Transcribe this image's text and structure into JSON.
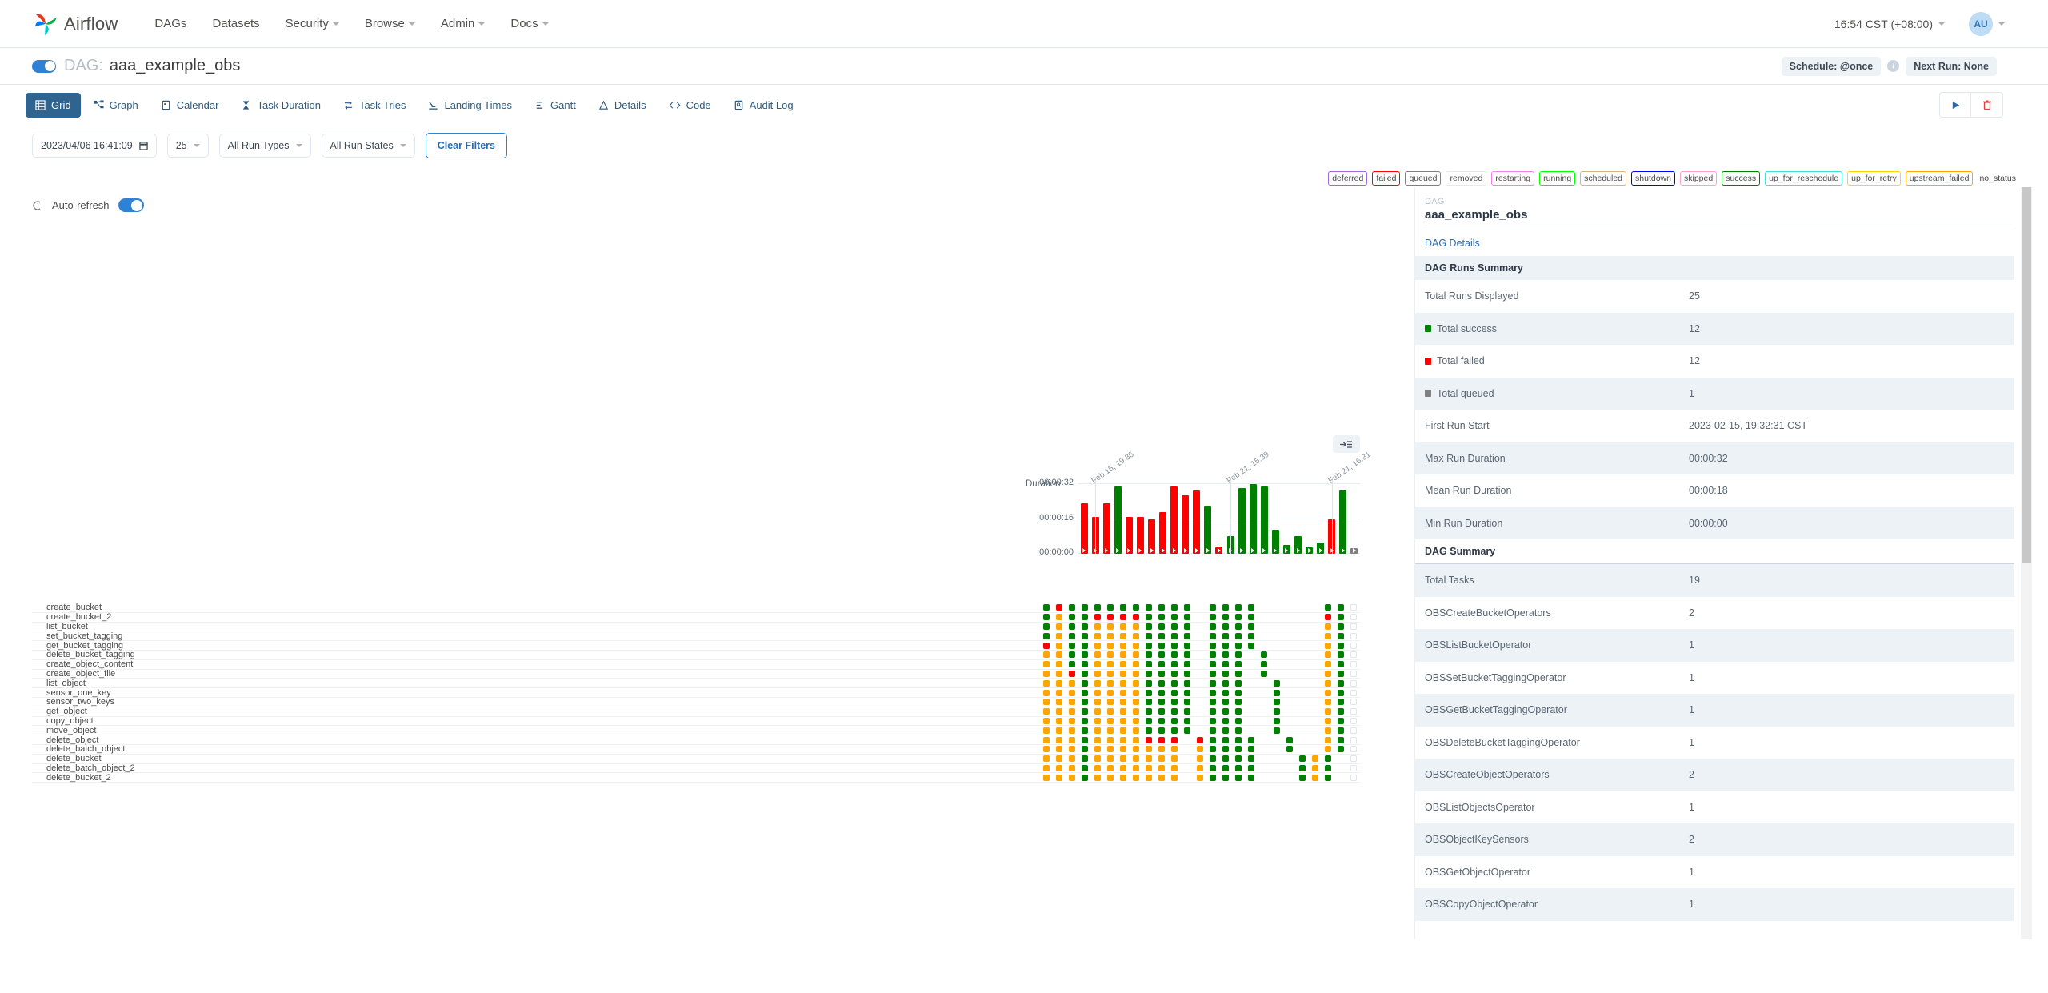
{
  "nav": {
    "brand": "Airflow",
    "items": [
      {
        "label": "DAGs",
        "caret": false
      },
      {
        "label": "Datasets",
        "caret": false
      },
      {
        "label": "Security",
        "caret": true
      },
      {
        "label": "Browse",
        "caret": true
      },
      {
        "label": "Admin",
        "caret": true
      },
      {
        "label": "Docs",
        "caret": true
      }
    ],
    "time": "16:54 CST (+08:00)",
    "avatar_initials": "AU"
  },
  "titlebar": {
    "dag_prefix": "DAG:",
    "dag_name": "aaa_example_obs",
    "schedule": "Schedule: @once",
    "next_run": "Next Run: None"
  },
  "tabs": [
    {
      "label": "Grid",
      "icon": "grid-icon",
      "active": true
    },
    {
      "label": "Graph",
      "icon": "graph-icon",
      "active": false
    },
    {
      "label": "Calendar",
      "icon": "calendar-icon",
      "active": false
    },
    {
      "label": "Task Duration",
      "icon": "hourglass-icon",
      "active": false
    },
    {
      "label": "Task Tries",
      "icon": "retry-icon",
      "active": false
    },
    {
      "label": "Landing Times",
      "icon": "landing-icon",
      "active": false
    },
    {
      "label": "Gantt",
      "icon": "gantt-icon",
      "active": false
    },
    {
      "label": "Details",
      "icon": "details-icon",
      "active": false
    },
    {
      "label": "Code",
      "icon": "code-icon",
      "active": false
    },
    {
      "label": "Audit Log",
      "icon": "auditlog-icon",
      "active": false
    }
  ],
  "actions": {
    "trigger": "play-icon",
    "delete": "trash-icon"
  },
  "filters": {
    "date_value": "2023/04/06 16:41:09",
    "count_value": "25",
    "run_types": "All Run Types",
    "run_states": "All Run States",
    "clear_label": "Clear Filters"
  },
  "legend": [
    {
      "label": "deferred",
      "color": "#9c6ade"
    },
    {
      "label": "failed",
      "color": "#ff0000"
    },
    {
      "label": "queued",
      "color": "#808080"
    },
    {
      "label": "removed",
      "color": "#e8e8e8"
    },
    {
      "label": "restarting",
      "color": "#ee82ee"
    },
    {
      "label": "running",
      "color": "#01ff00"
    },
    {
      "label": "scheduled",
      "color": "#d2b48c"
    },
    {
      "label": "shutdown",
      "color": "#0000ff"
    },
    {
      "label": "skipped",
      "color": "#ff9eca"
    },
    {
      "label": "success",
      "color": "#008000"
    },
    {
      "label": "up_for_reschedule",
      "color": "#40e0d0"
    },
    {
      "label": "up_for_retry",
      "color": "#ffd700"
    },
    {
      "label": "upstream_failed",
      "color": "#ffa500"
    },
    {
      "label": "no_status",
      "color": "none"
    }
  ],
  "autorefresh": {
    "label": "Auto-refresh",
    "on": true
  },
  "chart_data": {
    "type": "bar",
    "title": "Duration",
    "ylabel": "Duration",
    "ytick_labels": [
      "00:00:32",
      "00:00:16",
      "00:00:00"
    ],
    "ylim": [
      0,
      32
    ],
    "run_labels": [
      "Feb 15, 19:36",
      "Feb 21, 15:39",
      "Feb 21, 16:31"
    ],
    "run_label_positions": [
      1,
      13,
      22
    ],
    "values": [
      23,
      17,
      23,
      31,
      17,
      17,
      16,
      19,
      31,
      27,
      29,
      22,
      3,
      8,
      30,
      32,
      31,
      11,
      4,
      8,
      3,
      5,
      16,
      29,
      2
    ],
    "colors": [
      "#ff0000",
      "#ff0000",
      "#ff0000",
      "#008000",
      "#ff0000",
      "#ff0000",
      "#ff0000",
      "#ff0000",
      "#ff0000",
      "#ff0000",
      "#ff0000",
      "#008000",
      "#ff0000",
      "#008000",
      "#008000",
      "#008000",
      "#008000",
      "#008000",
      "#008000",
      "#008000",
      "#008000",
      "#008000",
      "#ff0000",
      "#008000",
      "#808080"
    ]
  },
  "task_grid": {
    "tasks": [
      "create_bucket",
      "create_bucket_2",
      "list_bucket",
      "set_bucket_tagging",
      "get_bucket_tagging",
      "delete_bucket_tagging",
      "create_object_content",
      "create_object_file",
      "list_object",
      "sensor_one_key",
      "sensor_two_keys",
      "get_object",
      "copy_object",
      "move_object",
      "delete_object",
      "delete_batch_object",
      "delete_bucket",
      "delete_batch_object_2",
      "delete_bucket_2"
    ],
    "states": [
      [
        "s",
        "f",
        "s",
        "s",
        "s",
        "s",
        "s",
        "s",
        "s",
        "s",
        "s",
        "s",
        "-",
        "s",
        "s",
        "s",
        "s",
        "-",
        "-",
        "-",
        "-",
        "-",
        "s",
        "s",
        "n"
      ],
      [
        "s",
        "r",
        "s",
        "s",
        "f",
        "f",
        "f",
        "f",
        "s",
        "s",
        "s",
        "s",
        "-",
        "s",
        "s",
        "s",
        "s",
        "-",
        "-",
        "-",
        "-",
        "-",
        "f",
        "s",
        "n"
      ],
      [
        "s",
        "r",
        "s",
        "s",
        "r",
        "r",
        "r",
        "r",
        "s",
        "s",
        "s",
        "s",
        "-",
        "s",
        "s",
        "s",
        "s",
        "-",
        "-",
        "-",
        "-",
        "-",
        "r",
        "s",
        "n"
      ],
      [
        "s",
        "r",
        "s",
        "s",
        "r",
        "r",
        "r",
        "r",
        "s",
        "s",
        "s",
        "s",
        "-",
        "s",
        "s",
        "s",
        "s",
        "-",
        "-",
        "-",
        "-",
        "-",
        "r",
        "s",
        "n"
      ],
      [
        "f",
        "r",
        "s",
        "s",
        "r",
        "r",
        "r",
        "r",
        "s",
        "s",
        "s",
        "s",
        "-",
        "s",
        "s",
        "s",
        "s",
        "-",
        "-",
        "-",
        "-",
        "-",
        "r",
        "s",
        "n"
      ],
      [
        "r",
        "r",
        "s",
        "s",
        "r",
        "r",
        "r",
        "r",
        "s",
        "s",
        "s",
        "s",
        "-",
        "s",
        "s",
        "s",
        "-",
        "s",
        "-",
        "-",
        "-",
        "-",
        "r",
        "s",
        "n"
      ],
      [
        "r",
        "r",
        "s",
        "s",
        "r",
        "r",
        "r",
        "r",
        "s",
        "s",
        "s",
        "s",
        "-",
        "s",
        "s",
        "s",
        "-",
        "s",
        "-",
        "-",
        "-",
        "-",
        "r",
        "s",
        "n"
      ],
      [
        "r",
        "r",
        "f",
        "s",
        "r",
        "r",
        "r",
        "r",
        "s",
        "s",
        "s",
        "s",
        "-",
        "s",
        "s",
        "s",
        "-",
        "s",
        "-",
        "-",
        "-",
        "-",
        "r",
        "s",
        "n"
      ],
      [
        "r",
        "r",
        "r",
        "s",
        "r",
        "r",
        "r",
        "r",
        "s",
        "s",
        "s",
        "s",
        "-",
        "s",
        "s",
        "s",
        "-",
        "-",
        "s",
        "-",
        "-",
        "-",
        "r",
        "s",
        "n"
      ],
      [
        "r",
        "r",
        "r",
        "s",
        "r",
        "r",
        "r",
        "r",
        "s",
        "s",
        "s",
        "s",
        "-",
        "s",
        "s",
        "s",
        "-",
        "-",
        "s",
        "-",
        "-",
        "-",
        "r",
        "s",
        "n"
      ],
      [
        "r",
        "r",
        "r",
        "s",
        "r",
        "r",
        "r",
        "r",
        "s",
        "s",
        "s",
        "s",
        "-",
        "s",
        "s",
        "s",
        "-",
        "-",
        "s",
        "-",
        "-",
        "-",
        "r",
        "s",
        "n"
      ],
      [
        "r",
        "r",
        "r",
        "s",
        "r",
        "r",
        "r",
        "r",
        "s",
        "s",
        "s",
        "s",
        "-",
        "s",
        "s",
        "s",
        "-",
        "-",
        "s",
        "-",
        "-",
        "-",
        "r",
        "s",
        "n"
      ],
      [
        "r",
        "r",
        "r",
        "s",
        "r",
        "r",
        "r",
        "r",
        "s",
        "s",
        "s",
        "s",
        "-",
        "s",
        "s",
        "s",
        "-",
        "-",
        "s",
        "-",
        "-",
        "-",
        "r",
        "s",
        "n"
      ],
      [
        "r",
        "r",
        "r",
        "s",
        "r",
        "r",
        "r",
        "r",
        "s",
        "s",
        "s",
        "s",
        "-",
        "s",
        "s",
        "s",
        "-",
        "-",
        "s",
        "-",
        "-",
        "-",
        "r",
        "s",
        "n"
      ],
      [
        "r",
        "r",
        "r",
        "s",
        "r",
        "r",
        "r",
        "r",
        "f",
        "f",
        "f",
        "-",
        "f",
        "s",
        "s",
        "s",
        "s",
        "-",
        "-",
        "s",
        "-",
        "-",
        "r",
        "s",
        "n"
      ],
      [
        "r",
        "r",
        "r",
        "s",
        "r",
        "r",
        "r",
        "r",
        "r",
        "r",
        "r",
        "-",
        "r",
        "s",
        "s",
        "s",
        "s",
        "-",
        "-",
        "s",
        "-",
        "-",
        "r",
        "s",
        "n"
      ],
      [
        "r",
        "r",
        "r",
        "s",
        "r",
        "r",
        "r",
        "r",
        "r",
        "r",
        "r",
        "-",
        "r",
        "s",
        "s",
        "s",
        "s",
        "-",
        "-",
        "-",
        "s",
        "r",
        "s",
        "-",
        "n"
      ],
      [
        "r",
        "r",
        "r",
        "s",
        "r",
        "r",
        "r",
        "r",
        "r",
        "r",
        "r",
        "-",
        "r",
        "s",
        "s",
        "s",
        "s",
        "-",
        "-",
        "-",
        "s",
        "r",
        "s",
        "-",
        "n"
      ],
      [
        "r",
        "r",
        "r",
        "s",
        "r",
        "r",
        "r",
        "r",
        "r",
        "r",
        "r",
        "-",
        "r",
        "s",
        "s",
        "s",
        "s",
        "-",
        "-",
        "-",
        "s",
        "r",
        "s",
        "-",
        "n"
      ]
    ],
    "state_colors": {
      "s": "#008000",
      "f": "#ff0000",
      "r": "#ffa500",
      "q": "#808080"
    }
  },
  "right_panel": {
    "dag_kicker": "DAG",
    "dag_name": "aaa_example_obs",
    "tab_label": "DAG Details",
    "runs_summary_title": "DAG Runs Summary",
    "runs_summary": [
      {
        "key": "Total Runs Displayed",
        "value": "25",
        "dot": null
      },
      {
        "key": "Total success",
        "value": "12",
        "dot": "#008000"
      },
      {
        "key": "Total failed",
        "value": "12",
        "dot": "#ff0000"
      },
      {
        "key": "Total queued",
        "value": "1",
        "dot": "#808080"
      },
      {
        "key": "First Run Start",
        "value": "2023-02-15, 19:32:31 CST",
        "dot": null
      },
      {
        "key": "Max Run Duration",
        "value": "00:00:32",
        "dot": null
      },
      {
        "key": "Mean Run Duration",
        "value": "00:00:18",
        "dot": null
      },
      {
        "key": "Min Run Duration",
        "value": "00:00:00",
        "dot": null
      }
    ],
    "dag_summary_title": "DAG Summary",
    "dag_summary": [
      {
        "key": "Total Tasks",
        "value": "19"
      },
      {
        "key": "OBSCreateBucketOperators",
        "value": "2"
      },
      {
        "key": "OBSListBucketOperator",
        "value": "1"
      },
      {
        "key": "OBSSetBucketTaggingOperator",
        "value": "1"
      },
      {
        "key": "OBSGetBucketTaggingOperator",
        "value": "1"
      },
      {
        "key": "OBSDeleteBucketTaggingOperator",
        "value": "1"
      },
      {
        "key": "OBSCreateObjectOperators",
        "value": "2"
      },
      {
        "key": "OBSListObjectsOperator",
        "value": "1"
      },
      {
        "key": "OBSObjectKeySensors",
        "value": "2"
      },
      {
        "key": "OBSGetObjectOperator",
        "value": "1"
      },
      {
        "key": "OBSCopyObjectOperator",
        "value": "1"
      }
    ]
  }
}
